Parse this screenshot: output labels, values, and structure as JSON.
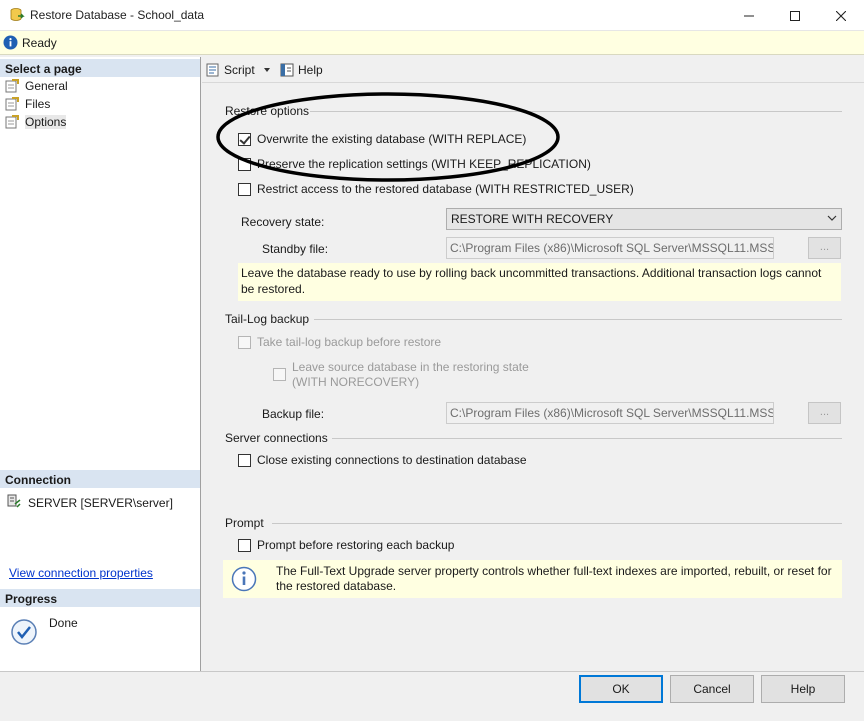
{
  "window": {
    "title": "Restore Database - School_data",
    "icon": "database-restore-icon"
  },
  "status": {
    "text": "Ready",
    "icon": "info-icon"
  },
  "left": {
    "select_page_header": "Select a page",
    "pages": [
      {
        "label": "General",
        "icon": "page-wrench-icon"
      },
      {
        "label": "Files",
        "icon": "page-wrench-icon"
      },
      {
        "label": "Options",
        "icon": "page-wrench-icon"
      }
    ],
    "connection_header": "Connection",
    "connection_value": "SERVER [SERVER\\server]",
    "connection_link": "View connection properties",
    "progress_header": "Progress",
    "progress_text": "Done"
  },
  "toolbar": {
    "script_label": "Script",
    "help_label": "Help"
  },
  "restore_options": {
    "group_label": "Restore options",
    "overwrite": {
      "label": "Overwrite the existing database (WITH REPLACE)",
      "checked": true
    },
    "preserve": {
      "label": "Preserve the replication settings (WITH KEEP_REPLICATION)",
      "checked": false
    },
    "restrict": {
      "label": "Restrict access to the restored database (WITH RESTRICTED_USER)",
      "checked": false
    },
    "recovery_label": "Recovery state:",
    "recovery_value": "RESTORE WITH RECOVERY",
    "standby_label": "Standby file:",
    "standby_value": "C:\\Program Files (x86)\\Microsoft SQL Server\\MSSQL11.MSSQ",
    "ellipsis_label": "...",
    "description": "Leave the database ready to use by rolling back uncommitted transactions. Additional transaction logs cannot be restored."
  },
  "tail_log": {
    "group_label": "Tail-Log backup",
    "take_tail": {
      "label": "Take tail-log backup before restore",
      "checked": false
    },
    "leave_restoring_line1": "Leave source database in the restoring state",
    "leave_restoring_line2": "(WITH NORECOVERY)",
    "backup_file_label": "Backup file:",
    "backup_file_value": "C:\\Program Files (x86)\\Microsoft SQL Server\\MSSQL11.MSSQ",
    "ellipsis_label": "..."
  },
  "server_connections": {
    "group_label": "Server connections",
    "close_existing": {
      "label": "Close existing connections to destination database",
      "checked": false
    }
  },
  "prompt": {
    "group_label": "Prompt",
    "prompt_before": {
      "label": "Prompt before restoring each backup",
      "checked": false
    },
    "info_text": "The Full-Text Upgrade server property controls whether full-text indexes are imported, rebuilt, or reset for the restored database."
  },
  "buttons": {
    "ok": "OK",
    "cancel": "Cancel",
    "help": "Help"
  },
  "colors": {
    "accent": "#0078d7",
    "header_bg": "#d9e4f1",
    "info_bg": "#ffffe1",
    "link": "#0033cc"
  }
}
